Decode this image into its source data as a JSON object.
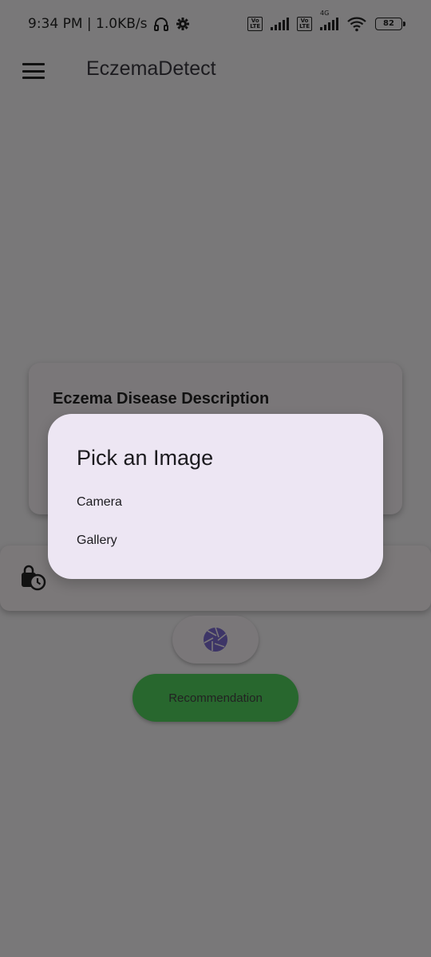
{
  "status_bar": {
    "time_speed": "9:34 PM | 1.0KB/s",
    "volte1": "Vo\nLTE",
    "volte2": "Vo\nLTE",
    "network": "4G",
    "battery": "82",
    "icons": [
      "headset-icon",
      "gear-icon",
      "signal-icon",
      "wifi-icon",
      "battery-icon"
    ]
  },
  "app_bar": {
    "title": "EczemaDetect",
    "menu_icon": "hamburger-menu-icon"
  },
  "description_card": {
    "title": "Eczema Disease Description"
  },
  "history": {
    "icon": "history-lock-clock-icon"
  },
  "camera_button": {
    "icon": "camera-aperture-icon",
    "icon_color": "#3d3567"
  },
  "recommendation_button": {
    "label": "Recommendation",
    "color": "#28672e"
  },
  "dialog": {
    "title": "Pick an Image",
    "options": [
      "Camera",
      "Gallery"
    ],
    "background": "#ede6f3"
  }
}
